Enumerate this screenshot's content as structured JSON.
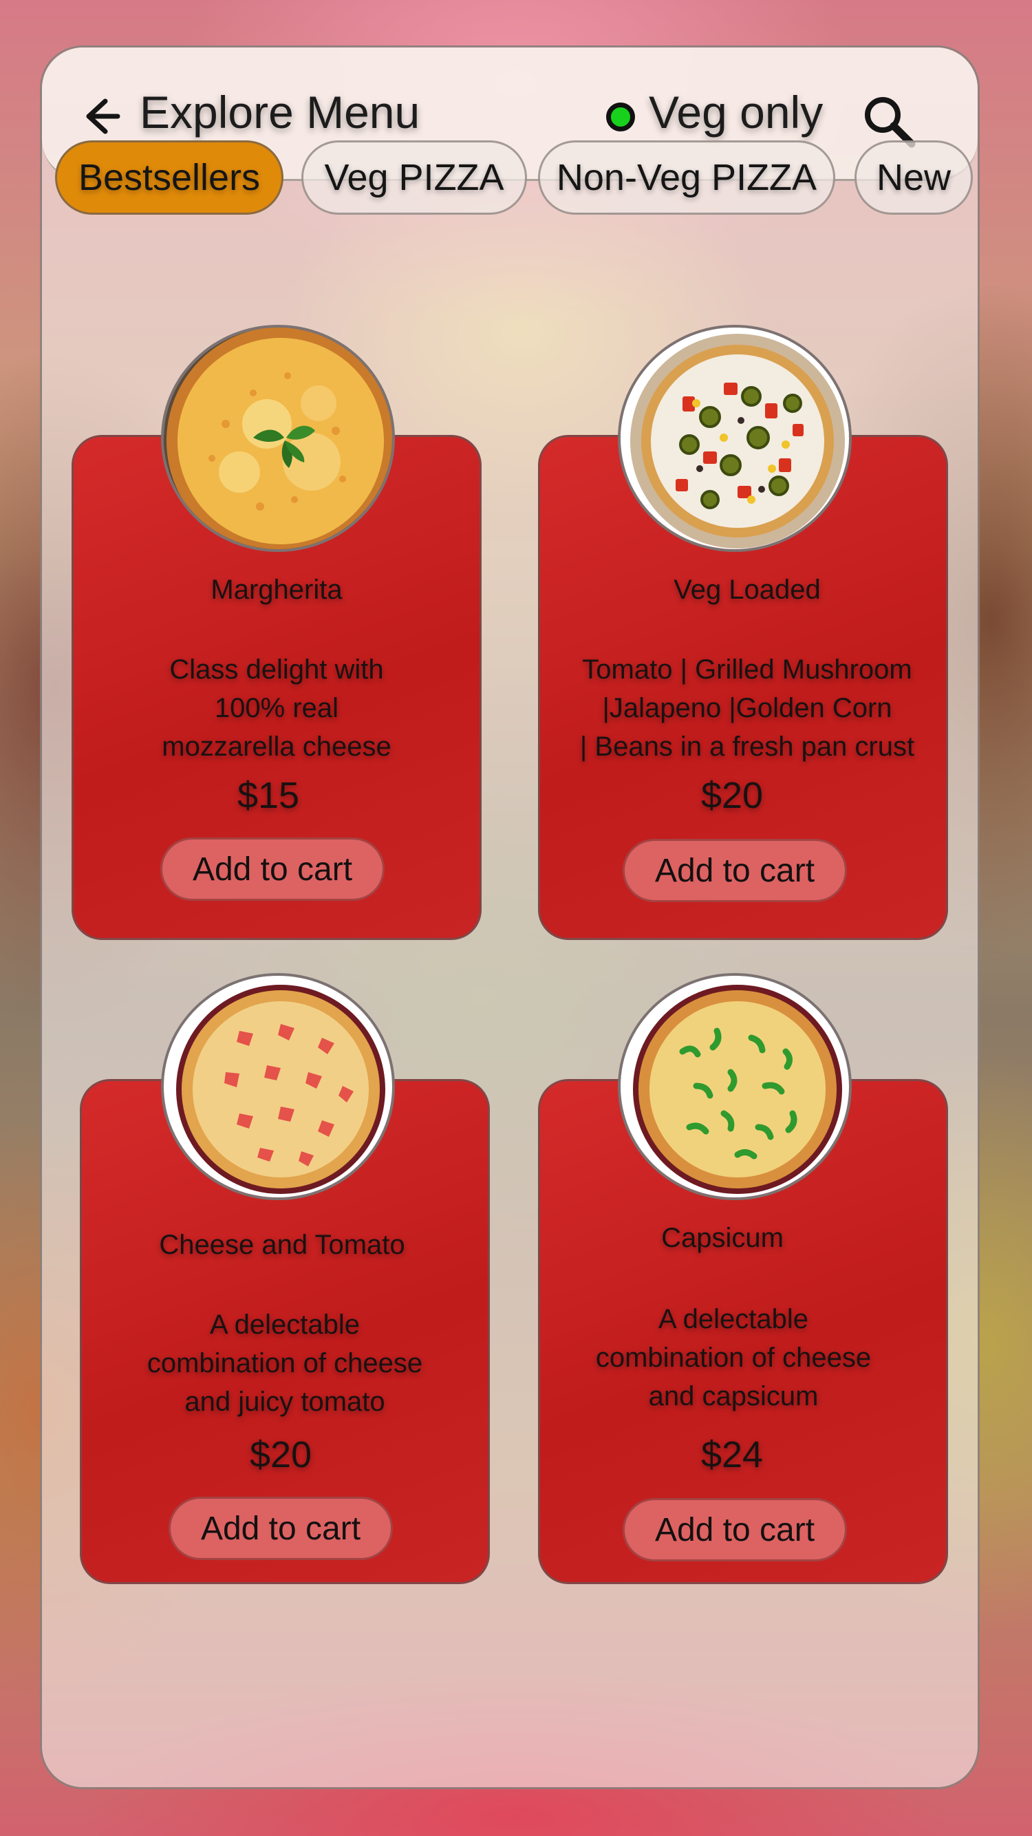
{
  "header": {
    "title": "Explore Menu",
    "veg_toggle_label": "Veg only"
  },
  "tabs": [
    {
      "label": "Bestsellers",
      "active": true
    },
    {
      "label": "Veg PIZZA",
      "active": false
    },
    {
      "label": "Non-Veg PIZZA",
      "active": false
    },
    {
      "label": "New",
      "active": false
    }
  ],
  "products": [
    {
      "name": "Margherita",
      "desc": [
        "Class delight with",
        "100% real",
        "mozzarella cheese"
      ],
      "price": "$15",
      "button": "Add to cart"
    },
    {
      "name": "Veg Loaded",
      "desc": [
        "Tomato | Grilled Mushroom",
        "|Jalapeno |Golden Corn",
        "| Beans in a fresh pan crust"
      ],
      "price": "$20",
      "button": "Add to cart"
    },
    {
      "name": "Cheese and Tomato",
      "desc": [
        "A delectable",
        "combination of cheese",
        "and juicy tomato"
      ],
      "price": "$20",
      "button": "Add to cart"
    },
    {
      "name": "Capsicum",
      "desc": [
        "A delectable",
        "combination of cheese",
        "and capsicum"
      ],
      "price": "$24",
      "button": "Add to cart"
    }
  ],
  "colors": {
    "accent_tab": "#e08a0a",
    "card_red": "#c81e1e",
    "button_pink": "#dd6262",
    "veg_indicator": "#18d11c"
  }
}
